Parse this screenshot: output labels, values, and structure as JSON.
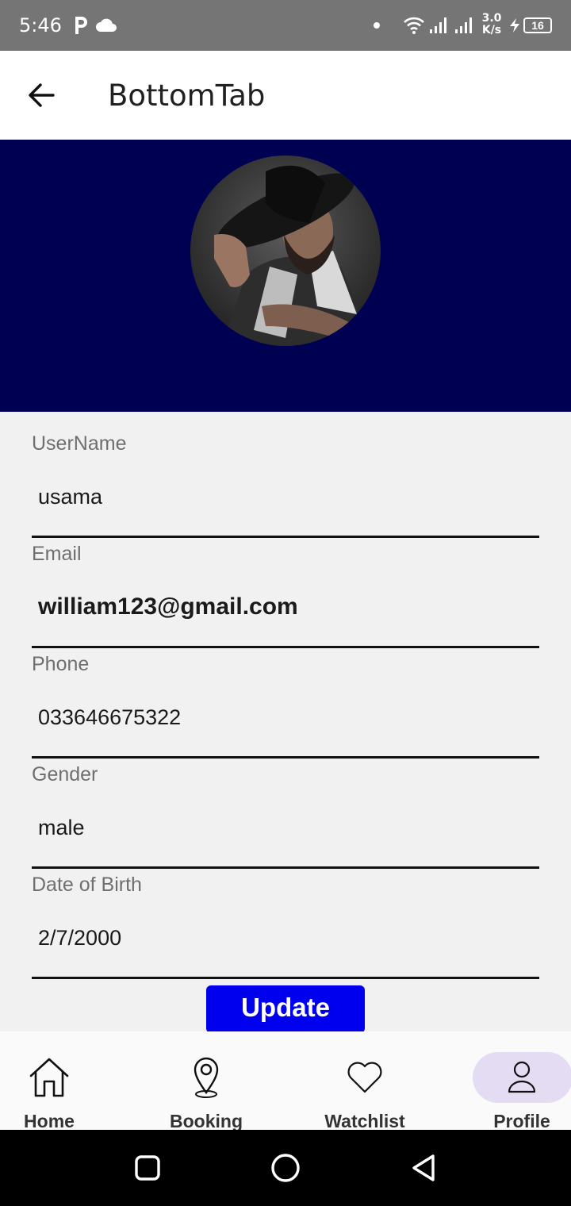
{
  "status_bar": {
    "time": "5:46",
    "network_speed_value": "3.0",
    "network_speed_unit": "K/s",
    "battery": "16"
  },
  "app_bar": {
    "title": "BottomTab"
  },
  "colors": {
    "header_bg": "#000052",
    "update_button": "#0000ee",
    "active_tab_pill": "#e4dcf2"
  },
  "form": {
    "fields": [
      {
        "label": "UserName",
        "value": "usama"
      },
      {
        "label": "Email",
        "value": "william123@gmail.com"
      },
      {
        "label": "Phone",
        "value": "033646675322"
      },
      {
        "label": "Gender",
        "value": "male"
      },
      {
        "label": "Date of Birth",
        "value": "2/7/2000"
      }
    ],
    "update_label": "Update"
  },
  "bottom_nav": {
    "items": [
      {
        "label": "Home",
        "icon": "home-icon"
      },
      {
        "label": "Booking",
        "icon": "location-pin-icon"
      },
      {
        "label": "Watchlist",
        "icon": "heart-icon"
      },
      {
        "label": "Profile",
        "icon": "person-icon"
      }
    ],
    "active": "Profile"
  }
}
